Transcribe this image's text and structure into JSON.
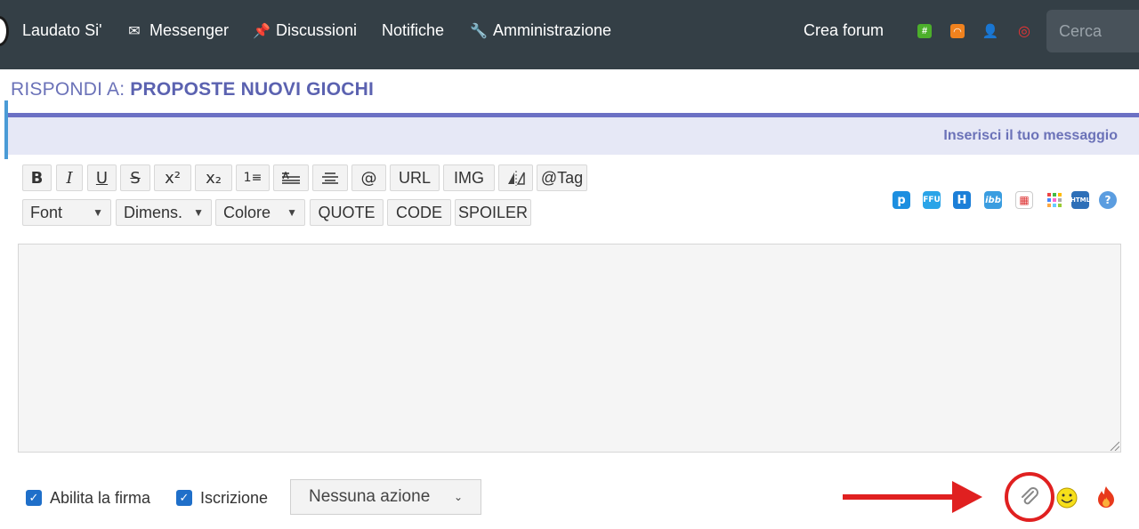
{
  "nav": {
    "brand": "Laudato Si'",
    "messenger": "Messenger",
    "discussions": "Discussioni",
    "notifications": "Notifiche",
    "admin": "Amministrazione",
    "create_forum": "Crea forum",
    "search_placeholder": "Cerca"
  },
  "page": {
    "title_prefix": "RISPONDI A:",
    "title_topic": "PROPOSTE NUOVI GIOCHI",
    "panel_header": "Inserisci il tuo messaggio"
  },
  "toolbar": {
    "bold": "B",
    "italic": "I",
    "underline": "U",
    "strike": "S",
    "superscript": "x²",
    "subscript": "x₂",
    "list": "1≡",
    "at": "@",
    "url": "URL",
    "img": "IMG",
    "tag": "@Tag",
    "font": "Font",
    "size": "Dimens.",
    "color": "Colore",
    "quote": "QUOTE",
    "code": "CODE",
    "spoiler": "SPOILER"
  },
  "footer": {
    "signature_label": "Abilita la firma",
    "subscribe_label": "Iscrizione",
    "action_value": "Nessuna azione"
  },
  "colors": {
    "topbar": "#343f46",
    "accent": "#6b70c4",
    "annotation": "#e02020"
  }
}
